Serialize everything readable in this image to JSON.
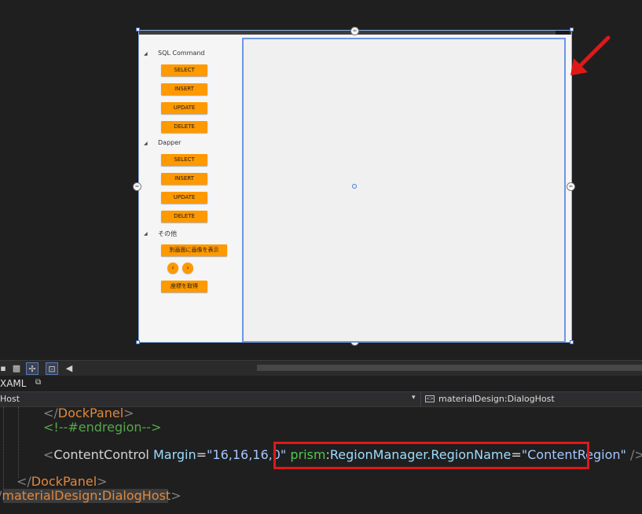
{
  "designer": {
    "groups": [
      {
        "label": "SQL Command",
        "buttons": [
          "SELECT",
          "INSERT",
          "UPDATE",
          "DELETE"
        ]
      },
      {
        "label": "Dapper",
        "buttons": [
          "SELECT",
          "INSERT",
          "UPDATE",
          "DELETE"
        ]
      },
      {
        "label": "その他",
        "buttons": [
          "別画面に画像を表示",
          "座標を取得"
        ]
      }
    ],
    "nav_prev": "‹",
    "nav_next": "›",
    "arrow_color": "#e01818"
  },
  "tabs": {
    "xaml": "XAML"
  },
  "navbar": {
    "left": "Host",
    "right": "materialDesign:DialogHost"
  },
  "code": {
    "l1_tag": "DockPanel",
    "l2_comment": "<!--#endregion-->",
    "l3_tag": "ContentControl",
    "l3_attr": "Margin",
    "l3_val": "\"16,16,16,0\"",
    "l3_ns": "prism",
    "l3_attr2": "RegionManager.RegionName",
    "l3_val2": "\"ContentRegion\"",
    "l4_tag": "DockPanel",
    "l5_ns": "materialDesign",
    "l5_tag": "DialogHost",
    "highlight_color": "#e01818"
  }
}
